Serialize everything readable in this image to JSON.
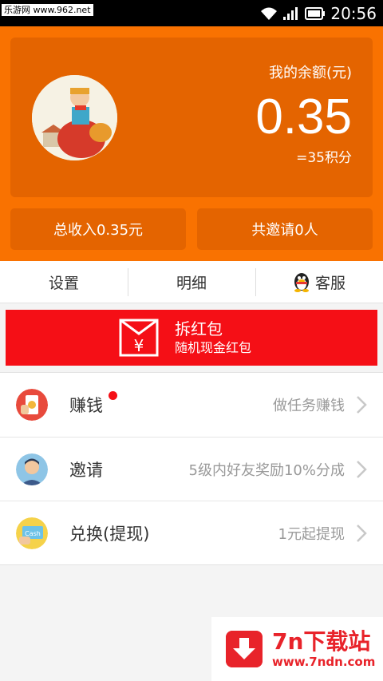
{
  "status_bar": {
    "watermark": "乐游网 www.962.net",
    "time": "20:56",
    "icons": [
      "wifi-icon",
      "signal-icon",
      "battery-icon"
    ]
  },
  "account": {
    "balance_label": "我的余额(元)",
    "balance_amount": "0.35",
    "points": "=35积分",
    "total_income": "总收入0.35元",
    "total_invited": "共邀请0人"
  },
  "tabs": [
    {
      "label": "设置"
    },
    {
      "label": "明细"
    },
    {
      "label": "客服",
      "icon": "qq-penguin-icon"
    }
  ],
  "red_packet": {
    "title": "拆红包",
    "subtitle": "随机现金红包",
    "icon": "red-envelope-yen-icon",
    "color": "#f50f16"
  },
  "menu": [
    {
      "title": "赚钱",
      "hint": "做任务赚钱",
      "icon": "phone-earn-icon",
      "badge": true
    },
    {
      "title": "邀请",
      "hint": "5级内好友奖励10%分成",
      "icon": "person-avatar-icon",
      "badge": false
    },
    {
      "title": "兑换(提现)",
      "hint": "1元起提现",
      "icon": "cash-card-icon",
      "badge": false
    }
  ],
  "watermark_bottom": {
    "name": "7n下载站",
    "url": "www.7ndn.com"
  },
  "colors": {
    "header_orange": "#f97201",
    "card_orange": "#e46400",
    "accent_red": "#f50f16"
  }
}
